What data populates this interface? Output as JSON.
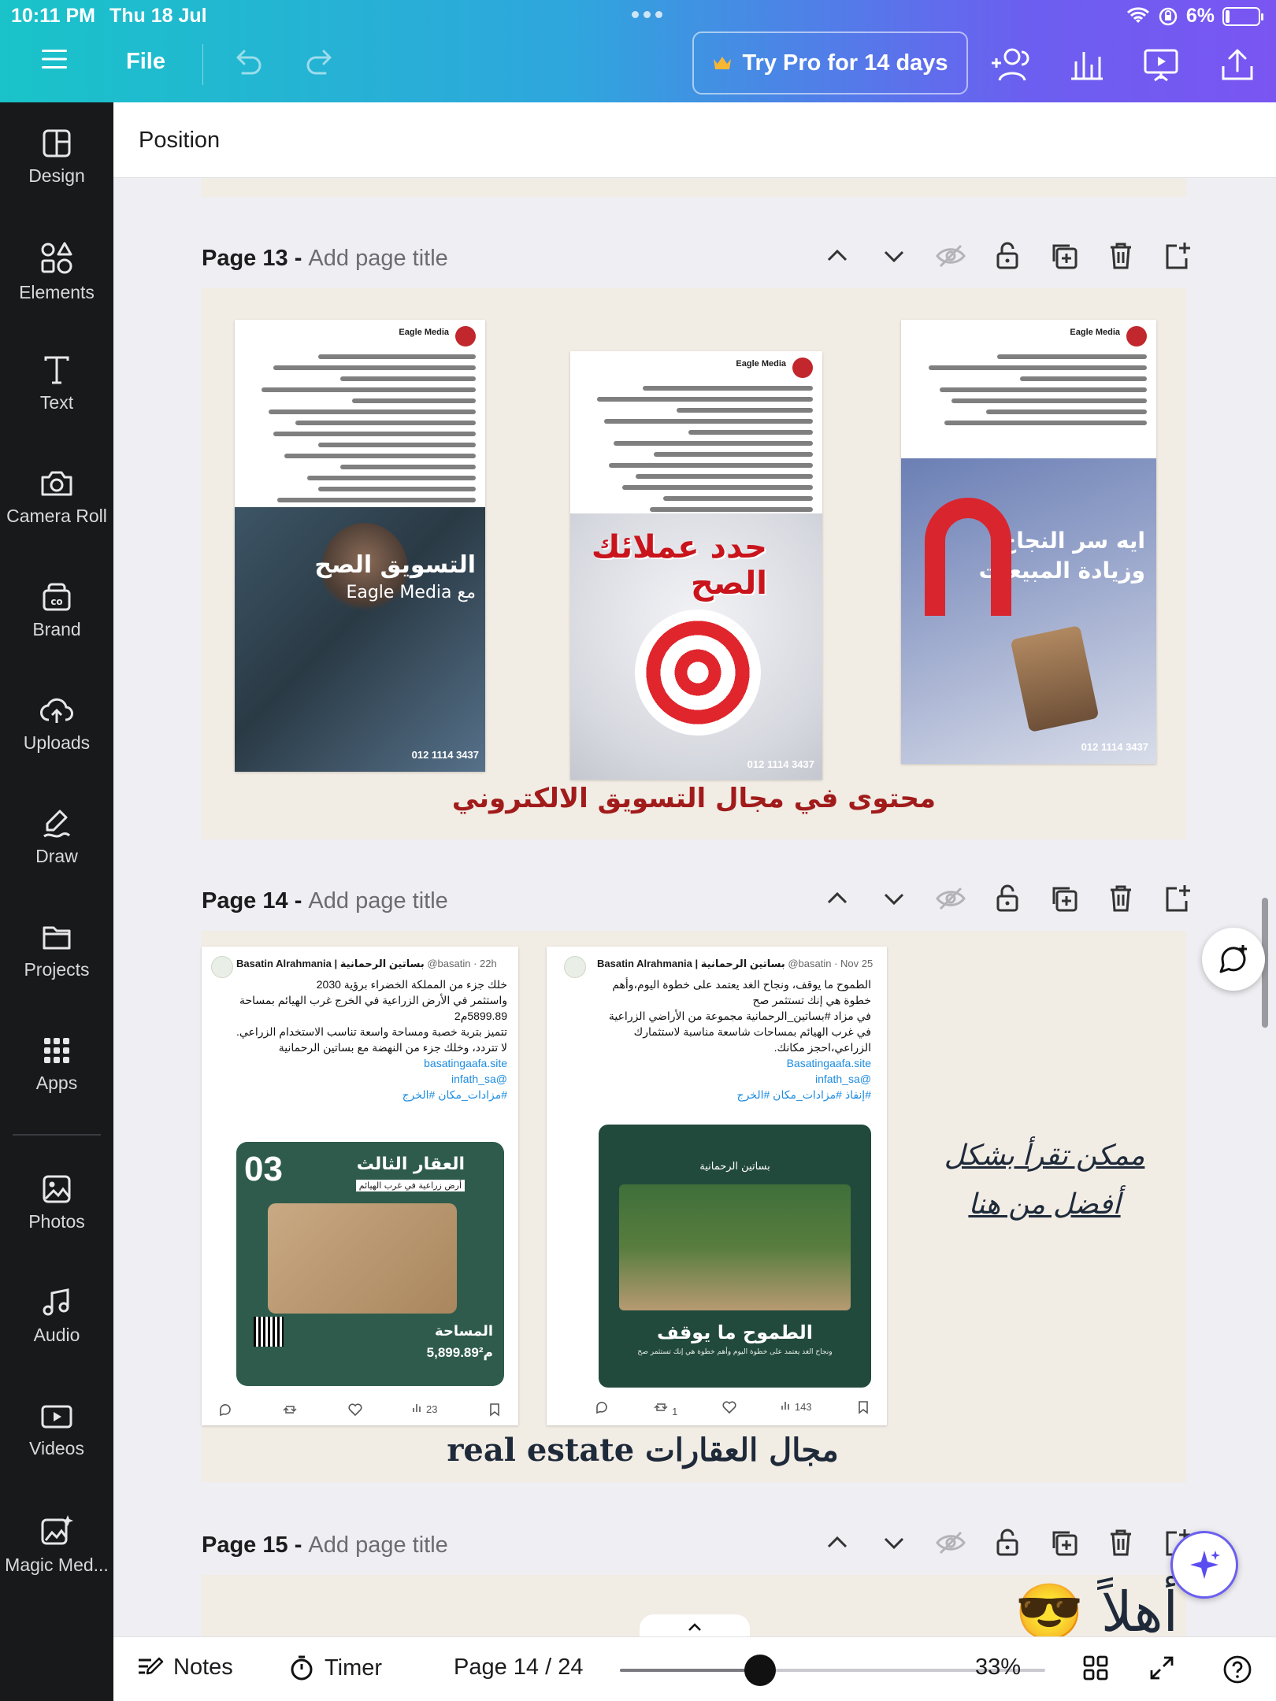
{
  "status": {
    "time": "10:11 PM",
    "date": "Thu 18 Jul",
    "battery": "6%"
  },
  "toolbar": {
    "file_label": "File",
    "try_pro_label": "Try Pro for 14 days"
  },
  "sidebar": {
    "items": [
      {
        "label": "Design",
        "icon": "design-icon"
      },
      {
        "label": "Elements",
        "icon": "elements-icon"
      },
      {
        "label": "Text",
        "icon": "text-icon"
      },
      {
        "label": "Camera Roll",
        "icon": "camera-icon"
      },
      {
        "label": "Brand",
        "icon": "brand-icon"
      },
      {
        "label": "Uploads",
        "icon": "upload-cloud-icon"
      },
      {
        "label": "Draw",
        "icon": "draw-icon"
      },
      {
        "label": "Projects",
        "icon": "folder-icon"
      },
      {
        "label": "Apps",
        "icon": "apps-grid-icon"
      },
      {
        "label": "Photos",
        "icon": "photo-icon"
      },
      {
        "label": "Audio",
        "icon": "music-note-icon"
      },
      {
        "label": "Videos",
        "icon": "video-icon"
      },
      {
        "label": "Magic Med...",
        "icon": "magic-media-icon"
      }
    ]
  },
  "panel": {
    "title": "Position"
  },
  "pages": [
    {
      "number": "Page 13",
      "separator": " - ",
      "title_placeholder": "Add page title",
      "caption": "محتوى في مجال التسويق الالكتروني",
      "cards": [
        {
          "author": "Eagle Media",
          "overlay": "التسويق الصح",
          "overlay2": "مع Eagle Media",
          "phone": "012 1114 3437"
        },
        {
          "author": "Eagle Media",
          "overlay": "حدد عملائك الصح",
          "phone": "012 1114 3437"
        },
        {
          "author": "Eagle Media",
          "overlay": "ايه سر النجاح وزيادة المبيعات",
          "phone": "012 1114 3437"
        }
      ]
    },
    {
      "number": "Page 14",
      "separator": " - ",
      "title_placeholder": "Add page title",
      "caption": "real estate مجال العقارات",
      "note_line1": "ممكن تقرأ بشكل",
      "note_line2": "أفضل من هنا",
      "tweets": [
        {
          "author": "Basatin Alrahmania | بساتين الرحمانية",
          "handle": "@basatin · 22h",
          "lines": [
            "خلك جزء من المملكة الخضراء برؤية 2030",
            "واستثمر في الأرض الزراعية في الخرج غرب الهيائم بمساحة 5899.89م2",
            "تتميز بتربة خصبة ومساحة واسعة تناسب الاستخدام الزراعي.",
            "لا تتردد، وخلك جزء من النهضة مع بساتين الرحمانية"
          ],
          "links": [
            "basatingaafa.site",
            "@infath_sa",
            "#مزادات_مكان #الخرج"
          ],
          "card_number": "03",
          "card_title": "العقار الثالث",
          "card_sub": "أرض زراعية في غرب الهيائم",
          "area_label": "المساحة",
          "area_value": "5,899.89م²",
          "views": "23"
        },
        {
          "author": "Basatin Alrahmania | بساتين الرحمانية",
          "handle": "@basatin · Nov 25",
          "lines": [
            "الطموح ما يوقف، ونجاح الغد يعتمد على خطوة اليوم،وأهم خطوة هي إنك تستثمر صح",
            "في مزاد #بساتين_الرحمانية مجموعة من الأراضي الزراعية في غرب الهيائم بمساحات شاسعة مناسبة لاستثمارك الزراعي،احجز مكانك."
          ],
          "links": [
            "Basatingaafa.site",
            "@infath_sa",
            "#إنفاذ #مزادات_مكان #الخرج"
          ],
          "card_brand": "بساتين الرحمانية",
          "card_title": "الطموح ما يوقف",
          "card_sub": "ونجاح الغد يعتمد على خطوة اليوم وأهم خطوة هي إنك تستثمر صح",
          "reposts": "1",
          "views": "143"
        }
      ]
    },
    {
      "number": "Page 15",
      "separator": " - ",
      "title_placeholder": "Add page title",
      "preview_text": "أهلاً 😎"
    }
  ],
  "bottombar": {
    "notes_label": "Notes",
    "timer_label": "Timer",
    "page_indicator": "Page 14 / 24",
    "zoom": "33%",
    "zoom_fraction": 0.33
  },
  "colors": {
    "gradient_start": "#19c3c9",
    "gradient_end": "#7a55f2",
    "sidebar_bg": "#18191b",
    "page_bg": "#f1ece4",
    "caption_red": "#a11b1b"
  }
}
